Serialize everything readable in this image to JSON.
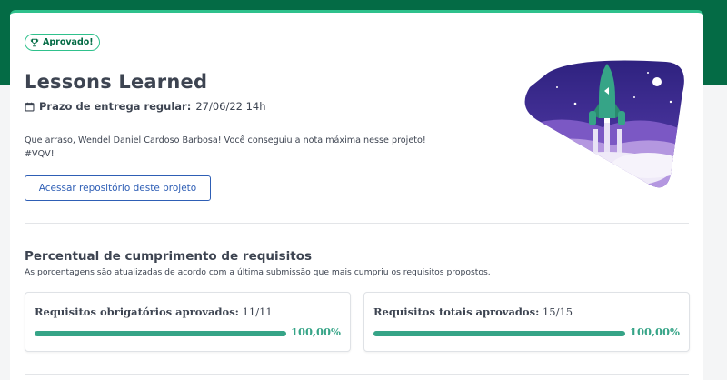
{
  "status_badge": {
    "label": "Aprovado!",
    "icon": "trophy-icon"
  },
  "project": {
    "title": "Lessons Learned",
    "deadline_label": "Prazo de entrega regular:",
    "deadline_value": "27/06/22 14h",
    "message_line1": "Que arraso, Wendel Daniel Cardoso Barbosa! Você conseguiu a nota máxima nesse projeto!",
    "message_line2": "#VQV!",
    "repo_button": "Acessar repositório deste projeto"
  },
  "requirements": {
    "title": "Percentual de cumprimento de requisitos",
    "subtitle": "As porcentagens são atualizadas de acordo com a última submissão que mais cumpriu os requisitos propostos.",
    "cards": [
      {
        "label": "Requisitos obrigatórios aprovados:",
        "value": "11/11",
        "percent_text": "100,00%",
        "percent": 100
      },
      {
        "label": "Requisitos totais aprovados:",
        "value": "15/15",
        "percent_text": "100,00%",
        "percent": 100
      }
    ]
  },
  "colors": {
    "brand_dark_green": "#046b45",
    "accent_green": "#2fc18c",
    "progress_green": "#36a487",
    "link_blue": "#2e5eb5",
    "illustration_purple": "#3b2a8c"
  }
}
